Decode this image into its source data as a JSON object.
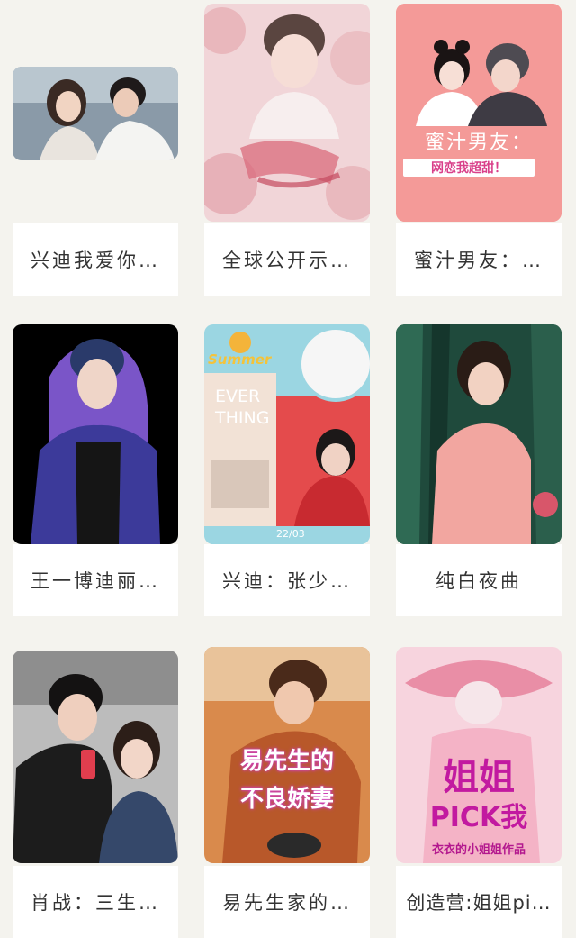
{
  "books": [
    {
      "title": "兴迪我爱你…",
      "cover_icon": "couple-photo-icon"
    },
    {
      "title": "全球公开示…",
      "cover_icon": "pink-poster-icon",
      "cover_text": ""
    },
    {
      "title": "蜜汁男友：…",
      "cover_icon": "illustration-couple-icon",
      "cover_text": "蜜汁男友：",
      "cover_subtext": "网恋我超甜！"
    },
    {
      "title": "王一博迪丽…",
      "cover_icon": "hoodie-portrait-icon"
    },
    {
      "title": "兴迪：张少…",
      "cover_icon": "collage-poster-icon",
      "cover_text": "EVER THING",
      "cover_subtext": "Summer",
      "cover_date": "22/03"
    },
    {
      "title": "纯白夜曲",
      "cover_icon": "portrait-curtain-icon"
    },
    {
      "title": "肖战：三生…",
      "cover_icon": "couple-selfie-icon"
    },
    {
      "title": "易先生家的…",
      "cover_icon": "romance-poster-icon",
      "cover_text": "易先生的",
      "cover_subtext": "不良娇妻"
    },
    {
      "title": "创造营:姐姐pi…",
      "cover_icon": "pink-hat-poster-icon",
      "cover_text": "姐姐",
      "cover_subtext": "PICK我",
      "cover_author": "衣衣的小姐姐作品"
    }
  ]
}
